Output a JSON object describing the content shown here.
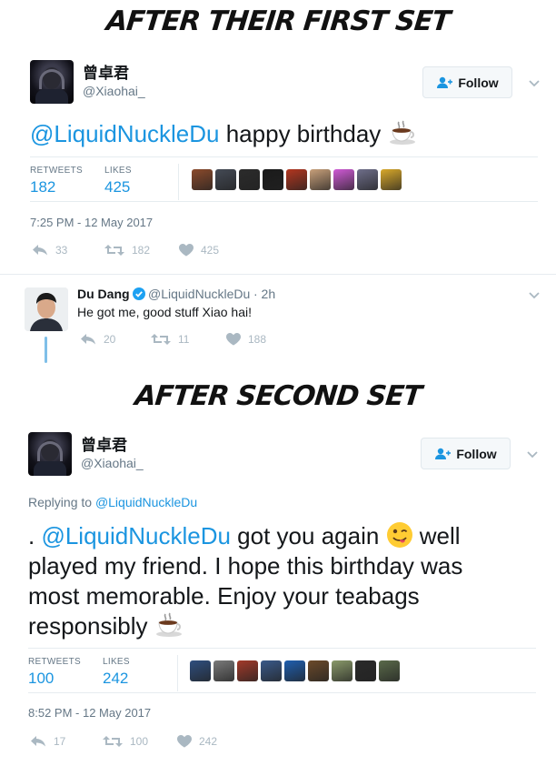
{
  "headings": {
    "first": "AFTER THEIR FIRST SET",
    "second": "AFTER SECOND SET"
  },
  "tweet1": {
    "author_name": "曾卓君",
    "author_handle": "@Xiaohai_",
    "follow_label": "Follow",
    "mention": "@LiquidNuckleDu",
    "text": " happy birthday ",
    "retweets_label": "RETWEETS",
    "retweets": "182",
    "likes_label": "LIKES",
    "likes": "425",
    "timestamp": "7:25 PM - 12 May 2017",
    "actions": {
      "reply": "33",
      "retweet": "182",
      "like": "425"
    },
    "liker_colors": [
      "#8b4a2b",
      "#444a55",
      "#2b2b2b",
      "#1a1a1a",
      "#b3361f",
      "#c8a07a",
      "#d05ad6",
      "#6e6e8a",
      "#d9a92a"
    ]
  },
  "reply": {
    "name": "Du Dang",
    "handle": "@LiquidNuckleDu",
    "time": "· 2h",
    "text": "He got me, good stuff Xiao hai!",
    "actions": {
      "reply": "20",
      "retweet": "11",
      "like": "188"
    }
  },
  "tweet2": {
    "author_name": "曾卓君",
    "author_handle": "@Xiaohai_",
    "follow_label": "Follow",
    "replying_prefix": "Replying to ",
    "replying_handle": "@LiquidNuckleDu",
    "line1_pre": ". ",
    "mention": "@LiquidNuckleDu",
    "line1_post": " got you again ",
    "line1_end": " well",
    "line2": "played my friend. I hope this birthday was",
    "line3": "most memorable. Enjoy your teabags",
    "line4": "responsibly ",
    "retweets_label": "RETWEETS",
    "retweets": "100",
    "likes_label": "LIKES",
    "likes": "242",
    "timestamp": "8:52 PM - 12 May 2017",
    "actions": {
      "reply": "17",
      "retweet": "100",
      "like": "242"
    },
    "liker_colors": [
      "#2f4f7f",
      "#7a7a7a",
      "#a33a2a",
      "#3a5a8a",
      "#1f5fb0",
      "#6b4a2a",
      "#8a9a6a",
      "#2a2a2a",
      "#5a6a4a"
    ]
  },
  "colors": {
    "link": "#1b95e0",
    "muted": "#657786",
    "icon": "#aab8c2",
    "verified": "#1da1f2"
  }
}
